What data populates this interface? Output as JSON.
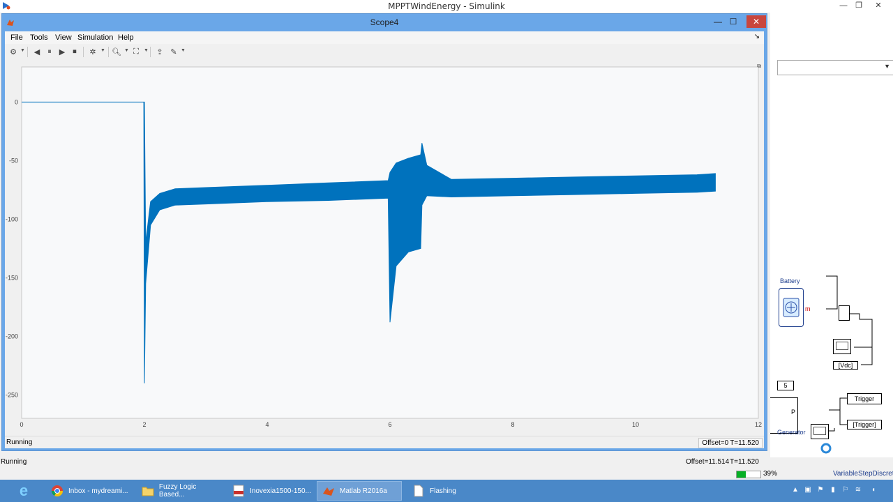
{
  "simulink": {
    "title": "MPPTWindEnergy - Simulink",
    "status_left": "Running",
    "offset": "Offset=11.514",
    "time": "T=11.520",
    "progress_percent": 39,
    "progress_text": "39%",
    "solver": "VariableStepDiscrete",
    "blocks": {
      "battery": "Battery",
      "m_out": "m",
      "vdc": "[Vdc]",
      "trigger": "Trigger",
      "trigger_goto": "[Trigger]",
      "generator": "Generator",
      "port_p": "P",
      "const_5": "5"
    }
  },
  "scope": {
    "title": "Scope4",
    "menus": [
      "File",
      "Tools",
      "View",
      "Simulation",
      "Help"
    ],
    "status": "Running",
    "offset": "Offset=0",
    "time": "T=11.520"
  },
  "chart_data": {
    "type": "line",
    "xlim": [
      0,
      12
    ],
    "ylim": [
      -270,
      30
    ],
    "xticks": [
      0,
      2,
      4,
      6,
      8,
      10,
      12
    ],
    "yticks": [
      0,
      -50,
      -100,
      -150,
      -200,
      -250
    ],
    "grid": false,
    "series": [
      {
        "color": "#0072bd",
        "envelope": [
          {
            "x": 0,
            "lo": 0,
            "hi": 0
          },
          {
            "x": 1.99,
            "lo": 0,
            "hi": 0
          },
          {
            "x": 2.0,
            "lo": -240,
            "hi": 0
          },
          {
            "x": 2.02,
            "lo": -155,
            "hi": -120
          },
          {
            "x": 2.1,
            "lo": -105,
            "hi": -85
          },
          {
            "x": 2.25,
            "lo": -92,
            "hi": -78
          },
          {
            "x": 2.5,
            "lo": -88,
            "hi": -74
          },
          {
            "x": 3.0,
            "lo": -87,
            "hi": -73
          },
          {
            "x": 4.0,
            "lo": -85,
            "hi": -71
          },
          {
            "x": 5.0,
            "lo": -84,
            "hi": -69
          },
          {
            "x": 5.97,
            "lo": -82,
            "hi": -67
          },
          {
            "x": 6.0,
            "lo": -188,
            "hi": -60
          },
          {
            "x": 6.1,
            "lo": -140,
            "hi": -52
          },
          {
            "x": 6.3,
            "lo": -128,
            "hi": -48
          },
          {
            "x": 6.5,
            "lo": -125,
            "hi": -45
          },
          {
            "x": 6.52,
            "lo": -88,
            "hi": -35
          },
          {
            "x": 6.6,
            "lo": -80,
            "hi": -54
          },
          {
            "x": 7.0,
            "lo": -81,
            "hi": -66
          },
          {
            "x": 8.0,
            "lo": -80,
            "hi": -65
          },
          {
            "x": 9.0,
            "lo": -79,
            "hi": -64
          },
          {
            "x": 10.0,
            "lo": -78,
            "hi": -63
          },
          {
            "x": 11.0,
            "lo": -77,
            "hi": -62
          },
          {
            "x": 11.3,
            "lo": -76,
            "hi": -61
          }
        ]
      }
    ]
  },
  "taskbar": {
    "items": [
      {
        "label": "Inbox - mydreami..."
      },
      {
        "label": "Fuzzy Logic Based..."
      },
      {
        "label": "Inovexia1500-150..."
      },
      {
        "label": "Matlab R2016a"
      },
      {
        "label": "Flashing"
      }
    ]
  }
}
